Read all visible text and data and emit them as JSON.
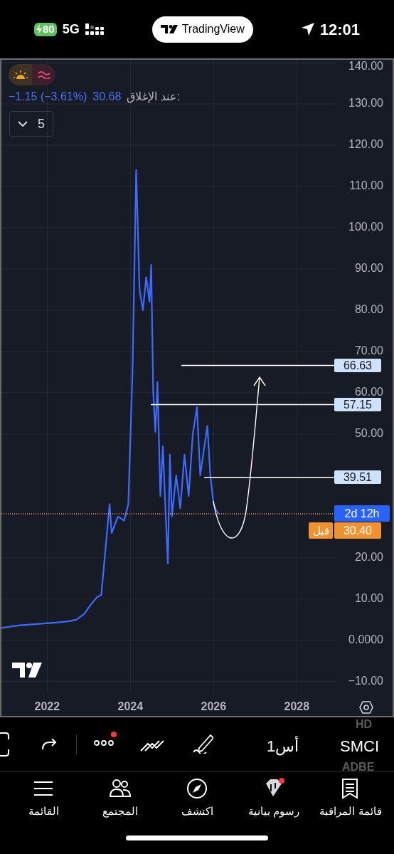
{
  "status_bar": {
    "battery": "80",
    "charging": true,
    "network": "5G",
    "app_badge": "TradingView",
    "time": "12:01"
  },
  "legend": {
    "close_label": "عند الإغلاق:",
    "close_price": "30.68",
    "change": "−1.15 (−3.61%)",
    "indicator_count": "5"
  },
  "chart": {
    "chart_data": {
      "type": "line",
      "x": [
        2020.9,
        2021.3,
        2021.8,
        2022.2,
        2022.5,
        2022.7,
        2022.9,
        2023.0,
        2023.2,
        2023.3,
        2023.4,
        2023.5,
        2023.55,
        2023.7,
        2023.85,
        2023.95,
        2024.05,
        2024.14,
        2024.22,
        2024.3,
        2024.38,
        2024.46,
        2024.5,
        2024.55,
        2024.6,
        2024.65,
        2024.72,
        2024.78,
        2024.85,
        2024.9,
        2024.95,
        2025.0,
        2025.1,
        2025.2,
        2025.3,
        2025.4,
        2025.5,
        2025.6,
        2025.68,
        2025.75,
        2025.85,
        2025.92,
        2026.0,
        2026.06,
        2026.12
      ],
      "series": [
        {
          "color": "#3d6bff",
          "values": [
            3.0,
            3.6,
            4.0,
            4.3,
            4.6,
            5.0,
            6.5,
            8.0,
            10.5,
            11.0,
            22.0,
            33.0,
            26.0,
            30.0,
            29.0,
            33.0,
            65.0,
            114.0,
            85.0,
            80.0,
            88.0,
            82.0,
            91.0,
            60.0,
            50.5,
            62.6,
            35.0,
            47.0,
            30.0,
            18.6,
            45.0,
            30.0,
            40.0,
            32.0,
            45.0,
            35.0,
            50.0,
            56.5,
            40.0,
            45.0,
            52.0,
            40.0,
            33.0,
            31.5,
            30.68
          ]
        }
      ],
      "xlim": [
        2020.9,
        2028.9
      ],
      "ylim": [
        -12.8,
        140.7
      ],
      "xticks": [
        2022,
        2024,
        2026,
        2028
      ],
      "yticks": [
        {
          "value": 140,
          "label": "140.00"
        },
        {
          "value": 130,
          "label": "130.00"
        },
        {
          "value": 120,
          "label": "120.00"
        },
        {
          "value": 110,
          "label": "110.00"
        },
        {
          "value": 100,
          "label": "100.00"
        },
        {
          "value": 90,
          "label": "90.00"
        },
        {
          "value": 80,
          "label": "80.00"
        },
        {
          "value": 70,
          "label": "70.00"
        },
        {
          "value": 60,
          "label": "60.00"
        },
        {
          "value": 50,
          "label": "50.00"
        },
        {
          "value": 20,
          "label": "20.00"
        },
        {
          "value": 10,
          "label": "10.00"
        },
        {
          "value": 0,
          "label": "0.0000"
        },
        {
          "value": -10,
          "label": "−10.00"
        }
      ],
      "grid": true,
      "ref_lines": [
        {
          "axis": "y",
          "value": 66.63,
          "label": "66.63",
          "color": "#ffffff"
        },
        {
          "axis": "y",
          "value": 57.15,
          "label": "57.15",
          "color": "#ffffff"
        },
        {
          "axis": "y",
          "value": 39.51,
          "label": "39.51",
          "color": "#ffffff"
        },
        {
          "axis": "y",
          "value": 30.68,
          "color": "#f5a05a"
        }
      ]
    },
    "price_marker": {
      "countdown": "2d 12h",
      "price": "30.40",
      "session": "قبل"
    }
  },
  "toolbar": {
    "symbol_prev": "HD",
    "symbol": "SMCI",
    "symbol_next": "ADBE",
    "interval": "1أس",
    "more_alert": true
  },
  "nav": [
    {
      "kind": "watchlist",
      "label": "قائمة المراقبة",
      "badge": false
    },
    {
      "kind": "charts",
      "label": "رسوم بيانية",
      "badge": true
    },
    {
      "kind": "explore",
      "label": "اكتشف",
      "badge": false
    },
    {
      "kind": "community",
      "label": "المجتمع",
      "badge": false
    },
    {
      "kind": "menu",
      "label": "القائمة",
      "badge": false
    }
  ]
}
